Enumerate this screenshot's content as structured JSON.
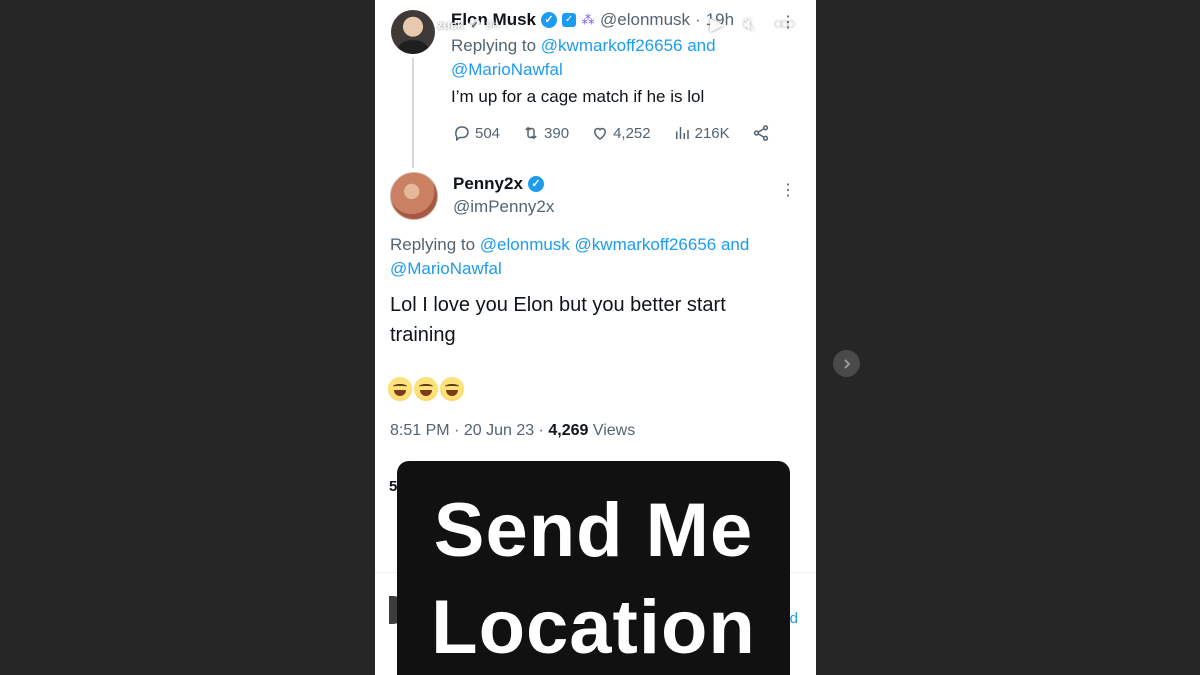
{
  "story": {
    "username": "zuck",
    "time": "9h",
    "controls": {
      "play_icon": "play-icon",
      "mute_icon": "mute-icon",
      "more_icon": "more-icon"
    }
  },
  "tweet_elon": {
    "name": "Elon Musk",
    "handle": "@elonmusk",
    "time": "19h",
    "replying_label": "Replying to",
    "replying_to": [
      "@kwmarkoff26656",
      "@MarioNawfal"
    ],
    "and_word": "and",
    "text": "I’m up for a cage match if he is lol",
    "replies": "504",
    "reposts": "390",
    "likes": "4,252",
    "views": "216K"
  },
  "tweet_penny": {
    "name": "Penny2x",
    "handle": "@imPenny2x",
    "replying_label": "Replying to",
    "replying_to": [
      "@elonmusk",
      "@kwmarkoff26656",
      "@MarioNawfal"
    ],
    "and_word": "and",
    "text_line1": "Lol I love you Elon but you better start",
    "text_line2": "training",
    "emoji_count": 3,
    "time": "8:51 PM",
    "date": "20 Jun 23",
    "views_count": "4,269",
    "views_label": "Views",
    "sep": "·"
  },
  "partial": {
    "left_digit": "5",
    "right_fragment": "d"
  },
  "sticker": {
    "line1": "Send Me",
    "line2": "Location"
  },
  "colors": {
    "link": "#1d9bf0",
    "muted": "#536471",
    "text": "#0f1419",
    "sticker_bg": "#111111",
    "backdrop": "#262626"
  }
}
